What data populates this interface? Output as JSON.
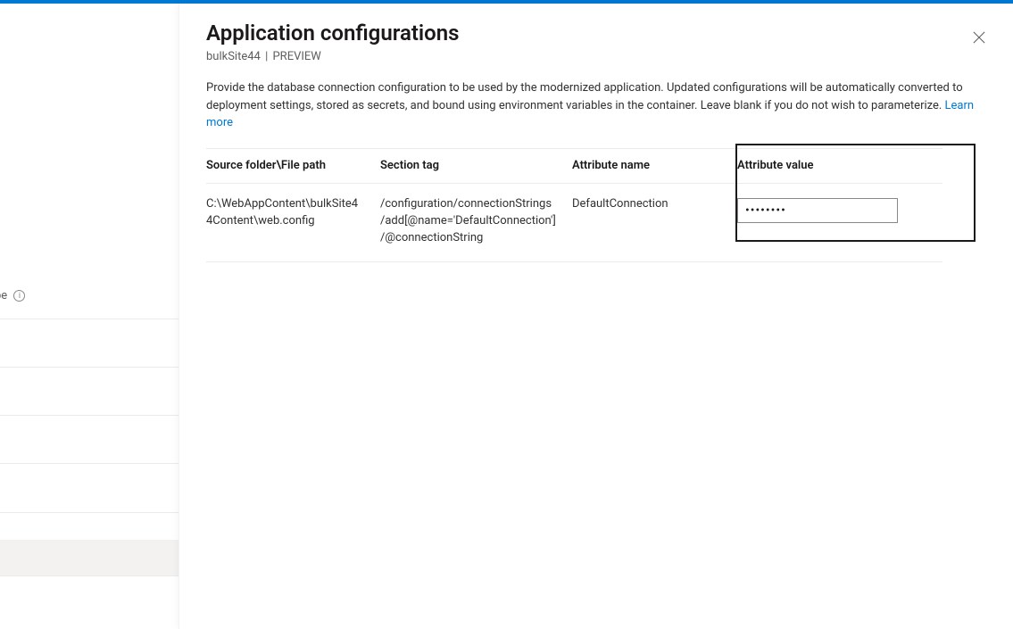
{
  "left": {
    "fragment_text": "pe",
    "info_label": "i"
  },
  "blade": {
    "title": "Application configurations",
    "subtitle_site": "bulkSite44",
    "subtitle_sep": " | ",
    "subtitle_badge": "PREVIEW",
    "close_label": "Close",
    "description": "Provide the database connection configuration to be used by the modernized application. Updated configurations will be automatically converted to deployment settings, stored as secrets, and bound using environment variables in the container. Leave blank if you do not wish to parameterize. ",
    "learn_more": "Learn more"
  },
  "table": {
    "headers": {
      "path": "Source folder\\File path",
      "section": "Section tag",
      "attr": "Attribute name",
      "value": "Attribute value"
    },
    "rows": [
      {
        "path": "C:\\WebAppContent\\bulkSite44Content\\web.config",
        "section": "/configuration/connectionStrings/add[@name='DefaultConnection']/@connectionString",
        "attr": "DefaultConnection",
        "value": "••••••••"
      }
    ]
  }
}
